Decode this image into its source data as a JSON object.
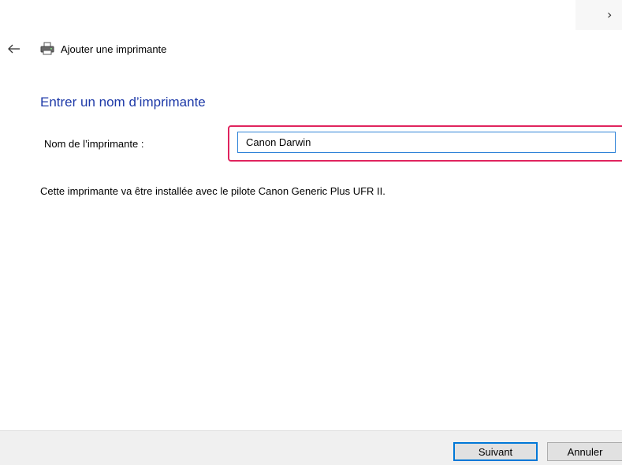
{
  "window": {
    "title": "Ajouter une imprimante",
    "close_glyph": "›",
    "icons": [
      "back-arrow-icon",
      "printer-icon",
      "close-icon"
    ]
  },
  "page": {
    "heading": "Entrer un nom d’imprimante",
    "name_label": "Nom de l’imprimante :",
    "name_value": "Canon Darwin",
    "info": "Cette imprimante va être installée avec le pilote Canon Generic Plus UFR II."
  },
  "footer": {
    "next_label": "Suivant",
    "cancel_label": "Annuler"
  },
  "colors": {
    "heading": "#1e3aa8",
    "input_focus_border": "#2f83d8",
    "highlight": "#e0245e",
    "footer_bg": "#f0f0f0",
    "default_button_border": "#0078d7"
  }
}
